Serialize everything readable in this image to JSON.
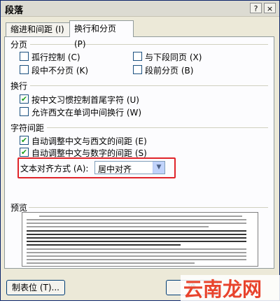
{
  "window": {
    "title": "段落",
    "help_btn": "?",
    "close_btn": "×"
  },
  "tabs": [
    {
      "label": "缩进和间距 (I)",
      "active": false
    },
    {
      "label": "换行和分页 (P)",
      "active": true
    }
  ],
  "pagination": {
    "title": "分页",
    "widow_control": {
      "label": "孤行控制 (C)",
      "checked": false
    },
    "keep_with_next": {
      "label": "与下段同页 (X)",
      "checked": false
    },
    "keep_lines_together": {
      "label": "段中不分页 (K)",
      "checked": false
    },
    "page_break_before": {
      "label": "段前分页 (B)",
      "checked": false
    }
  },
  "line_break": {
    "title": "换行",
    "east_asian_rules": {
      "label": "按中文习惯控制首尾字符 (U)",
      "checked": true
    },
    "allow_latin_wrap": {
      "label": "允许西文在单词中间换行 (W)",
      "checked": false
    }
  },
  "char_spacing": {
    "title": "字符间距",
    "auto_space_latin": {
      "label": "自动调整中文与西文的间距 (E)",
      "checked": true
    },
    "auto_space_numbers": {
      "label": "自动调整中文与数字的间距 (S)",
      "checked": true
    },
    "text_alignment_label": "文本对齐方式 (A):",
    "text_alignment_value": "居中对齐"
  },
  "preview": {
    "title": "预览"
  },
  "buttons": {
    "tabs_btn": "制表位 (T)...",
    "ok_btn": "确"
  },
  "watermark": {
    "text": "云南龙网"
  },
  "colors": {
    "check": "#21a121",
    "highlight": "#e0242a",
    "watermark": "#e8432c"
  }
}
